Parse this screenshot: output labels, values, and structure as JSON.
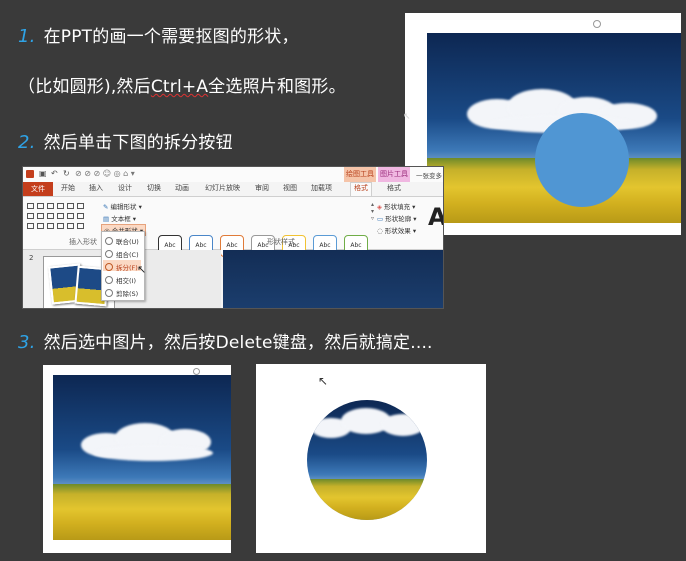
{
  "steps": {
    "s1": {
      "num": "1.",
      "line1": "在PPT的画一个需要抠图的形状，",
      "line2_pre": "（比如圆形),然后",
      "line2_key": "Ctrl+A",
      "line2_post": "全选照片和图形。"
    },
    "s2": {
      "num": "2.",
      "text": "然后单击下图的拆分按钮"
    },
    "s3": {
      "num": "3.",
      "text": "然后选中图片，然后按Delete键盘，然后就搞定...."
    }
  },
  "ppt": {
    "ctx_tab_drawing": "绘图工具",
    "ctx_tab_picture": "图片工具",
    "right_partial": "一张变多",
    "file_tab": "文件",
    "tabs": [
      "开始",
      "插入",
      "设计",
      "切换",
      "动画",
      "幻灯片放映",
      "审阅",
      "视图",
      "加载项",
      "格式",
      "格式"
    ],
    "ribbon": {
      "edit_shape": "编辑形状",
      "text_box": "文本框",
      "merge_shapes": "合并形状",
      "group_insert": "插入形状",
      "group_styles": "形状样式",
      "style_samples": [
        "Abc",
        "Abc",
        "Abc",
        "Abc",
        "Abc",
        "Abc",
        "Abc"
      ],
      "shape_fill": "形状填充",
      "shape_outline": "形状轮廓",
      "shape_effects": "形状效果",
      "big_a": "A"
    },
    "merge_menu": [
      "联合(U)",
      "组合(C)",
      "拆分(F)",
      "相交(I)",
      "剪除(S)"
    ],
    "slide_number": "2"
  },
  "colors": {
    "accent_number": "#2fa3e6",
    "circle_fill": "#5096d3",
    "file_tab": "#c43e1c",
    "background": "#3a3a3a"
  }
}
